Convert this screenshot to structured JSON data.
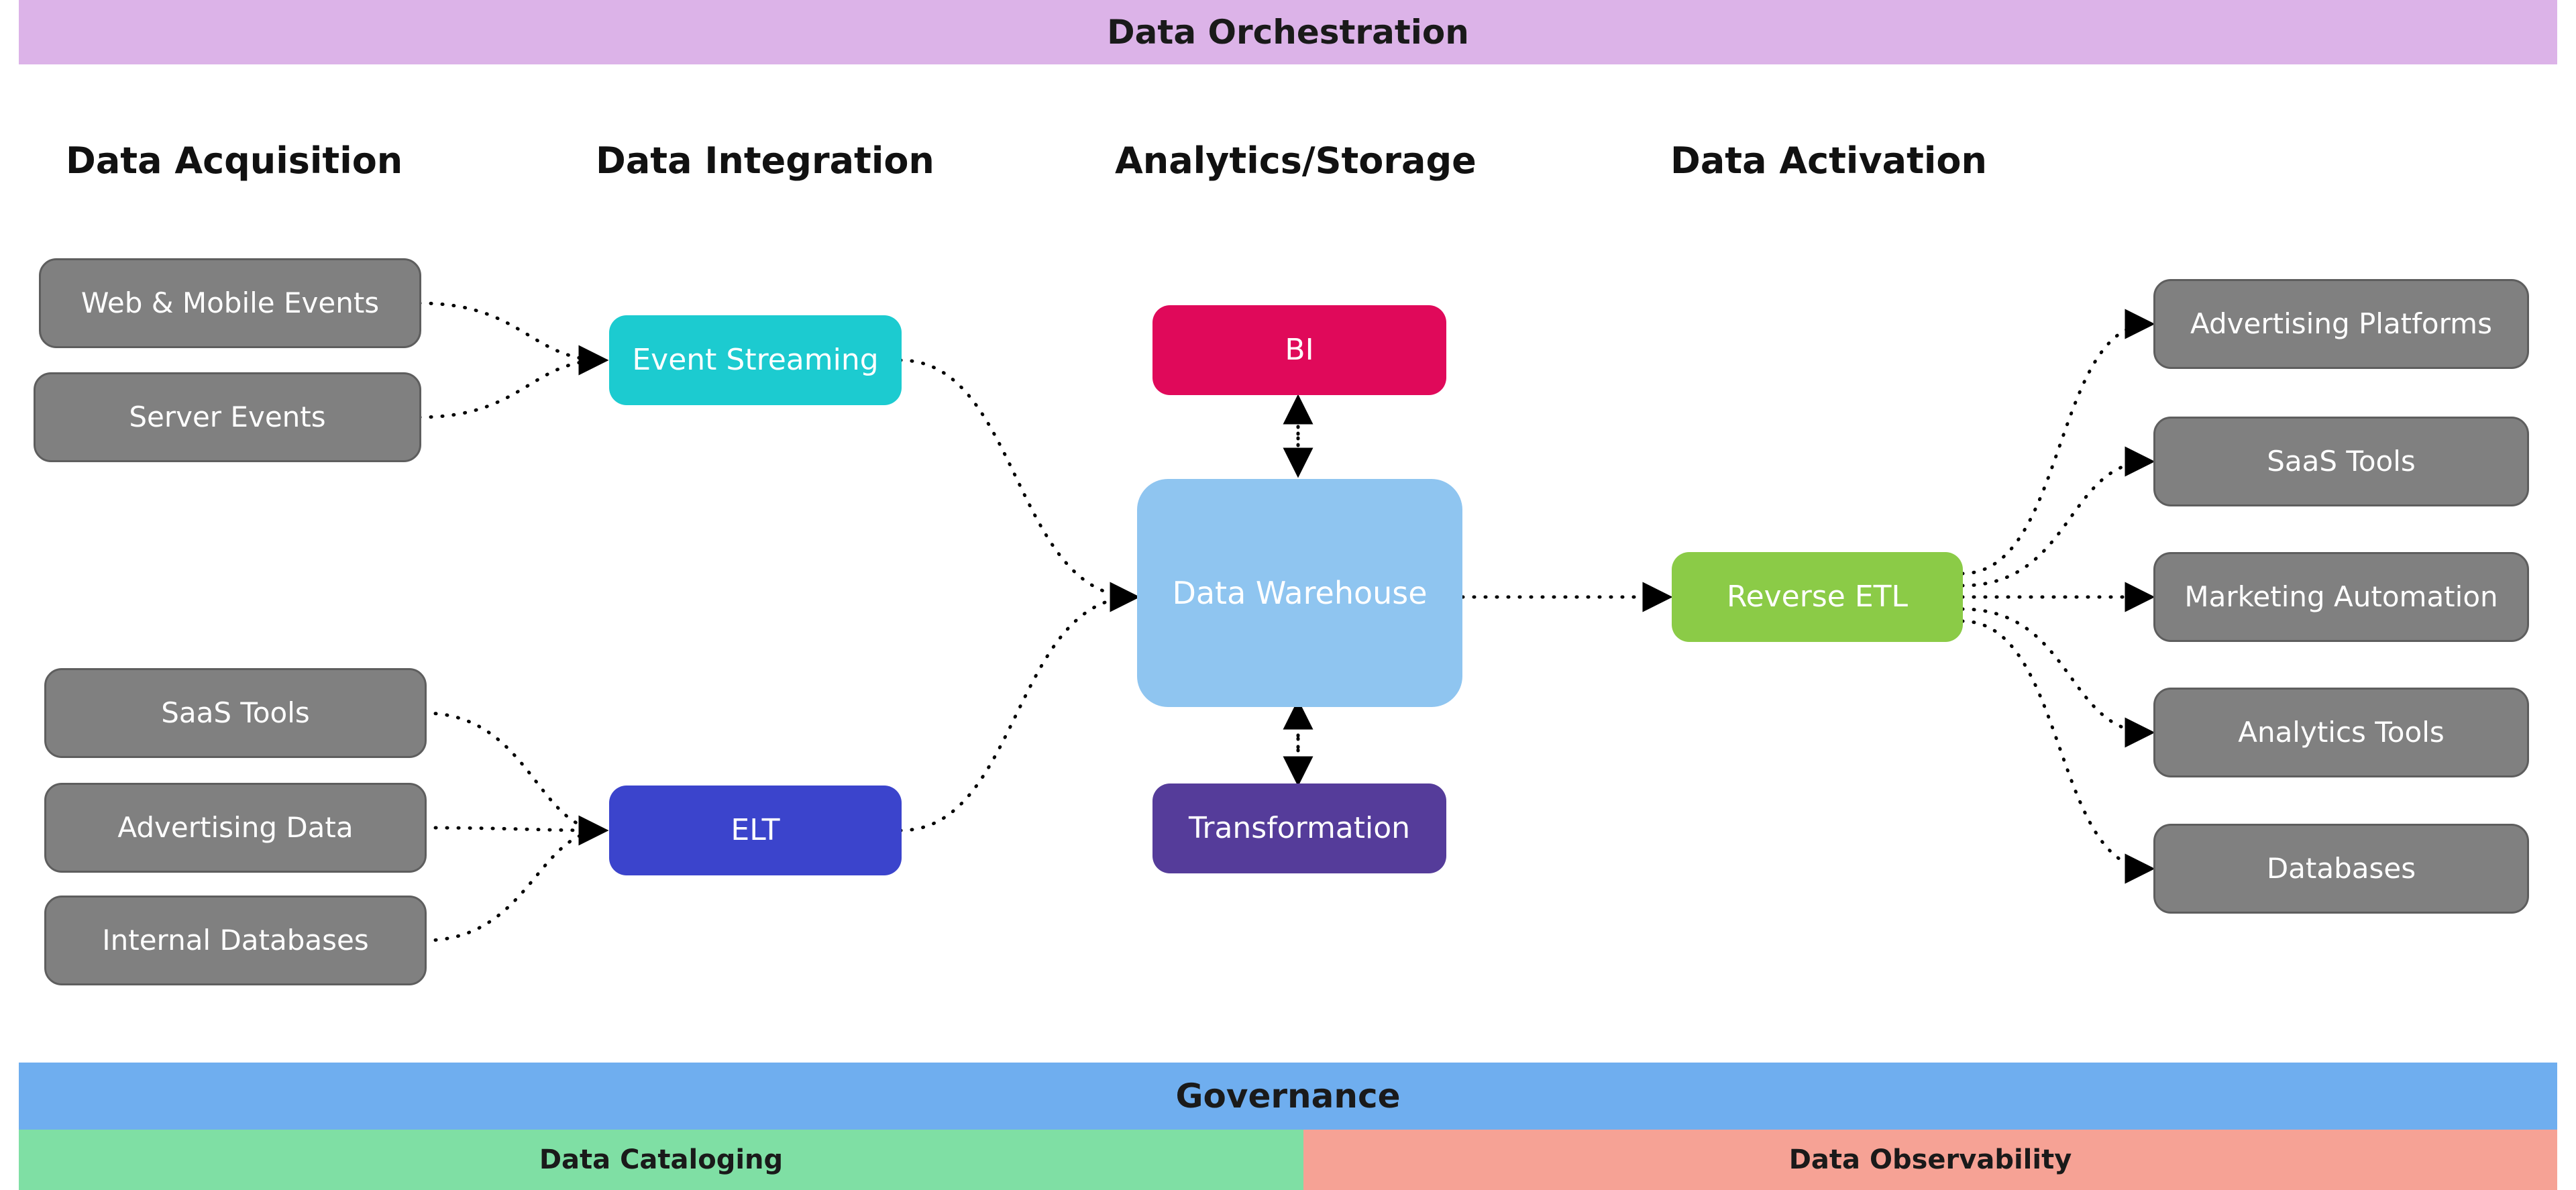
{
  "banners": {
    "orchestration": {
      "label": "Data Orchestration",
      "color": "#DCB3E8"
    },
    "governance": {
      "label": "Governance",
      "color": "#6FAEEF"
    },
    "cataloging": {
      "label": "Data Cataloging",
      "color": "#7FDFA4"
    },
    "observability": {
      "label": "Data Observability",
      "color": "#F6A295"
    }
  },
  "columns": [
    {
      "id": "acquisition",
      "label": "Data Acquisition"
    },
    {
      "id": "integration",
      "label": "Data Integration"
    },
    {
      "id": "analytics",
      "label": "Analytics/Storage"
    },
    {
      "id": "activation",
      "label": "Data Activation"
    }
  ],
  "nodes": {
    "sources": [
      {
        "id": "web-mobile-events",
        "label": "Web & Mobile Events",
        "color": "#808080"
      },
      {
        "id": "server-events",
        "label": "Server Events",
        "color": "#808080"
      },
      {
        "id": "saas-tools-src",
        "label": "SaaS Tools",
        "color": "#808080"
      },
      {
        "id": "advertising-data",
        "label": "Advertising Data",
        "color": "#808080"
      },
      {
        "id": "internal-databases",
        "label": "Internal Databases",
        "color": "#808080"
      }
    ],
    "integration": [
      {
        "id": "event-streaming",
        "label": "Event Streaming",
        "color": "#1CCBD0"
      },
      {
        "id": "elt",
        "label": "ELT",
        "color": "#3B44CC"
      }
    ],
    "analytics": [
      {
        "id": "bi",
        "label": "BI",
        "color": "#E0095A"
      },
      {
        "id": "data-warehouse",
        "label": "Data Warehouse",
        "color": "#8FC5F0"
      },
      {
        "id": "transformation",
        "label": "Transformation",
        "color": "#553C9A"
      }
    ],
    "activation_hub": {
      "id": "reverse-etl",
      "label": "Reverse ETL",
      "color": "#8BCB47"
    },
    "destinations": [
      {
        "id": "advertising-platforms",
        "label": "Advertising Platforms",
        "color": "#808080"
      },
      {
        "id": "saas-tools-dest",
        "label": "SaaS Tools",
        "color": "#808080"
      },
      {
        "id": "marketing-automation",
        "label": "Marketing Automation",
        "color": "#808080"
      },
      {
        "id": "analytics-tools",
        "label": "Analytics Tools",
        "color": "#808080"
      },
      {
        "id": "databases-dest",
        "label": "Databases",
        "color": "#808080"
      }
    ]
  },
  "edges": [
    {
      "from": "web-mobile-events",
      "to": "event-streaming",
      "style": "dotted"
    },
    {
      "from": "server-events",
      "to": "event-streaming",
      "style": "dotted"
    },
    {
      "from": "saas-tools-src",
      "to": "elt",
      "style": "dotted"
    },
    {
      "from": "advertising-data",
      "to": "elt",
      "style": "dotted"
    },
    {
      "from": "internal-databases",
      "to": "elt",
      "style": "dotted"
    },
    {
      "from": "event-streaming",
      "to": "data-warehouse",
      "style": "dotted"
    },
    {
      "from": "elt",
      "to": "data-warehouse",
      "style": "dotted"
    },
    {
      "from": "data-warehouse",
      "to": "bi",
      "style": "dotted-bidirectional"
    },
    {
      "from": "data-warehouse",
      "to": "transformation",
      "style": "dotted-bidirectional"
    },
    {
      "from": "data-warehouse",
      "to": "reverse-etl",
      "style": "dotted"
    },
    {
      "from": "reverse-etl",
      "to": "advertising-platforms",
      "style": "dotted"
    },
    {
      "from": "reverse-etl",
      "to": "saas-tools-dest",
      "style": "dotted"
    },
    {
      "from": "reverse-etl",
      "to": "marketing-automation",
      "style": "dotted"
    },
    {
      "from": "reverse-etl",
      "to": "analytics-tools",
      "style": "dotted"
    },
    {
      "from": "reverse-etl",
      "to": "databases-dest",
      "style": "dotted"
    }
  ]
}
